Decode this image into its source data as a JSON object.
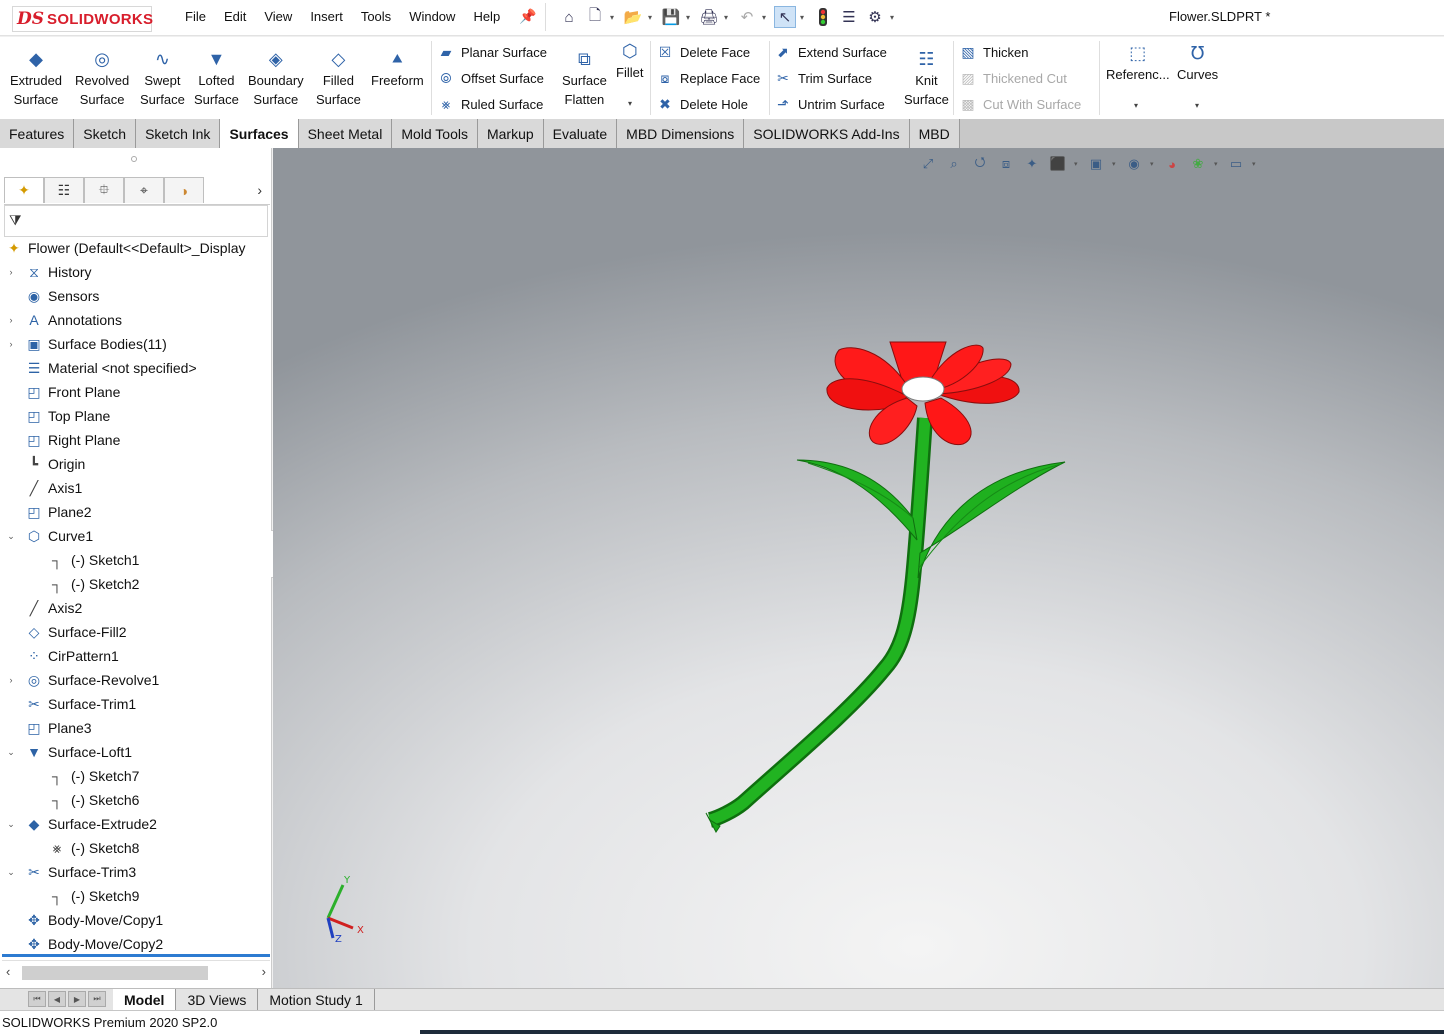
{
  "app": {
    "logo_ds": "DS",
    "logo_text": "SOLIDWORKS",
    "document_title": "Flower.SLDPRT *"
  },
  "menus": [
    "File",
    "Edit",
    "View",
    "Insert",
    "Tools",
    "Window",
    "Help"
  ],
  "quick_access": [
    "home-icon",
    "new-document-icon",
    "open-icon",
    "save-icon",
    "print-icon",
    "undo-icon",
    "select-icon",
    "rebuild-icon",
    "file-properties-icon",
    "options-icon"
  ],
  "ribbon": {
    "extruded": "Extruded Surface",
    "extruded_1": "Extruded",
    "extruded_2": "Surface",
    "revolved_1": "Revolved",
    "revolved_2": "Surface",
    "swept_1": "Swept",
    "swept_2": "Surface",
    "lofted_1": "Lofted",
    "lofted_2": "Surface",
    "boundary_1": "Boundary",
    "boundary_2": "Surface",
    "filled_1": "Filled",
    "filled_2": "Surface",
    "freeform": "Freeform",
    "planar": "Planar Surface",
    "offset": "Offset Surface",
    "ruled": "Ruled Surface",
    "flatten_1": "Surface",
    "flatten_2": "Flatten",
    "fillet": "Fillet",
    "delete_face": "Delete Face",
    "replace_face": "Replace Face",
    "delete_hole": "Delete Hole",
    "extend": "Extend Surface",
    "trim": "Trim Surface",
    "untrim": "Untrim Surface",
    "knit_1": "Knit",
    "knit_2": "Surface",
    "thicken": "Thicken",
    "thickened_cut": "Thickened Cut",
    "cut_with_surface": "Cut With Surface",
    "reference": "Referenc...",
    "curves": "Curves"
  },
  "tabs": [
    "Features",
    "Sketch",
    "Sketch Ink",
    "Surfaces",
    "Sheet Metal",
    "Mold Tools",
    "Markup",
    "Evaluate",
    "MBD Dimensions",
    "SOLIDWORKS Add-Ins",
    "MBD"
  ],
  "active_tab": "Surfaces",
  "tree": {
    "root": "Flower  (Default<<Default>_Display",
    "items": [
      {
        "label": "History",
        "indent": 0,
        "expander": "right",
        "icon": "history-icon"
      },
      {
        "label": "Sensors",
        "indent": 0,
        "expander": "",
        "icon": "sensor-icon"
      },
      {
        "label": "Annotations",
        "indent": 0,
        "expander": "right",
        "icon": "annotations-icon"
      },
      {
        "label": "Surface Bodies(11)",
        "indent": 0,
        "expander": "right",
        "icon": "surface-bodies-icon"
      },
      {
        "label": "Material <not specified>",
        "indent": 0,
        "expander": "",
        "icon": "material-icon"
      },
      {
        "label": "Front Plane",
        "indent": 0,
        "expander": "",
        "icon": "plane-icon"
      },
      {
        "label": "Top Plane",
        "indent": 0,
        "expander": "",
        "icon": "plane-icon"
      },
      {
        "label": "Right Plane",
        "indent": 0,
        "expander": "",
        "icon": "plane-icon"
      },
      {
        "label": "Origin",
        "indent": 0,
        "expander": "",
        "icon": "origin-icon"
      },
      {
        "label": "Axis1",
        "indent": 0,
        "expander": "",
        "icon": "axis-icon"
      },
      {
        "label": "Plane2",
        "indent": 0,
        "expander": "",
        "icon": "plane-icon"
      },
      {
        "label": "Curve1",
        "indent": 0,
        "expander": "down",
        "icon": "curve-icon"
      },
      {
        "label": "(-) Sketch1",
        "indent": 1,
        "expander": "",
        "icon": "sketch-icon"
      },
      {
        "label": "(-) Sketch2",
        "indent": 1,
        "expander": "",
        "icon": "sketch-icon"
      },
      {
        "label": "Axis2",
        "indent": 0,
        "expander": "",
        "icon": "axis-icon"
      },
      {
        "label": "Surface-Fill2",
        "indent": 0,
        "expander": "",
        "icon": "surface-fill-icon"
      },
      {
        "label": "CirPattern1",
        "indent": 0,
        "expander": "",
        "icon": "circular-pattern-icon"
      },
      {
        "label": "Surface-Revolve1",
        "indent": 0,
        "expander": "right",
        "icon": "surface-revolve-icon"
      },
      {
        "label": "Surface-Trim1",
        "indent": 0,
        "expander": "",
        "icon": "surface-trim-icon"
      },
      {
        "label": "Plane3",
        "indent": 0,
        "expander": "",
        "icon": "plane-icon"
      },
      {
        "label": "Surface-Loft1",
        "indent": 0,
        "expander": "down",
        "icon": "surface-loft-icon"
      },
      {
        "label": "(-) Sketch7",
        "indent": 1,
        "expander": "",
        "icon": "sketch-icon"
      },
      {
        "label": "(-) Sketch6",
        "indent": 1,
        "expander": "",
        "icon": "sketch-icon"
      },
      {
        "label": "Surface-Extrude2",
        "indent": 0,
        "expander": "down",
        "icon": "surface-extrude-icon"
      },
      {
        "label": "(-) Sketch8",
        "indent": 1,
        "expander": "",
        "icon": "sketch-3d-icon"
      },
      {
        "label": "Surface-Trim3",
        "indent": 0,
        "expander": "down",
        "icon": "surface-trim-icon"
      },
      {
        "label": "(-) Sketch9",
        "indent": 1,
        "expander": "",
        "icon": "sketch-icon"
      },
      {
        "label": "Body-Move/Copy1",
        "indent": 0,
        "expander": "",
        "icon": "move-copy-icon"
      },
      {
        "label": "Body-Move/Copy2",
        "indent": 0,
        "expander": "",
        "icon": "move-copy-icon"
      }
    ]
  },
  "panel_tabs": [
    "feature-manager-icon",
    "property-manager-icon",
    "configuration-manager-icon",
    "dimxpert-icon",
    "display-manager-icon"
  ],
  "triad": {
    "x": "X",
    "y": "Y",
    "z": "Z"
  },
  "bottom_tabs": [
    "Model",
    "3D Views",
    "Motion Study 1"
  ],
  "active_bottom_tab": "Model",
  "status": "SOLIDWORKS Premium 2020 SP2.0",
  "colors": {
    "petal": "#ff1a1a",
    "stem": "#1aa51a",
    "accent": "#2d7bd1",
    "logo": "#d81e2c"
  }
}
